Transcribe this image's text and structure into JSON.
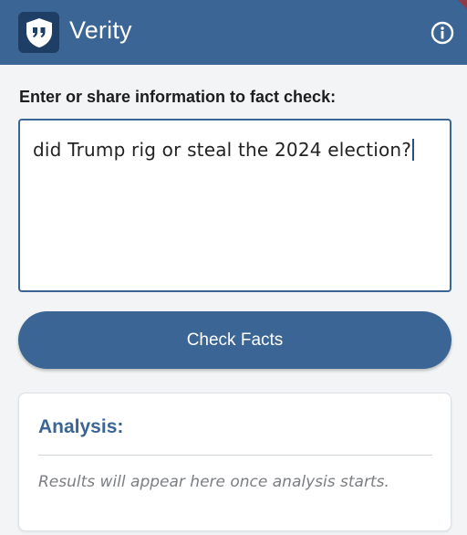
{
  "header": {
    "title": "Verity",
    "logo_icon": "shield-quote-icon",
    "info_icon": "info-icon"
  },
  "form": {
    "label": "Enter or share information to fact check:",
    "input_value": "did Trump rig or steal the 2024 election?",
    "submit_label": "Check Facts"
  },
  "analysis": {
    "title": "Analysis:",
    "placeholder": "Results will appear here once analysis starts."
  },
  "colors": {
    "brand": "#3b6594",
    "brand_dark": "#1f3e66",
    "background": "#f2f4f6"
  }
}
